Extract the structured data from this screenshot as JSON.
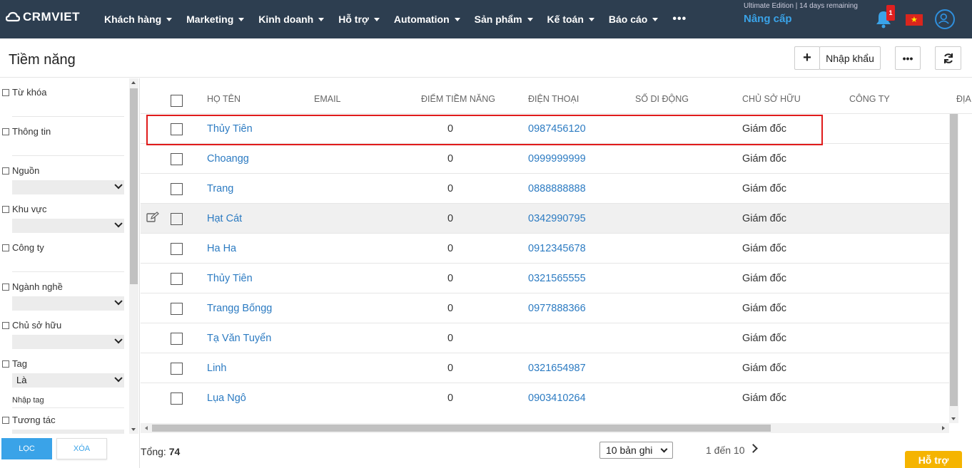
{
  "app": {
    "logo": "CRMVIET"
  },
  "nav": [
    {
      "label": "Khách hàng"
    },
    {
      "label": "Marketing"
    },
    {
      "label": "Kinh doanh"
    },
    {
      "label": "Hỗ trợ"
    },
    {
      "label": "Automation"
    },
    {
      "label": "Sản phẩm"
    },
    {
      "label": "Kế toán"
    },
    {
      "label": "Báo cáo"
    }
  ],
  "nav_more": "•••",
  "edition": "Ultimate Edition | 14 days remaining",
  "upgrade": "Nâng cấp",
  "notif_count": "1",
  "page": {
    "title": "Tiềm năng",
    "add": "+",
    "import": "Nhập khẩu",
    "more": "•••",
    "refresh": "⟳"
  },
  "filters": {
    "keyword": "Từ khóa",
    "info": "Thông tin",
    "source": "Nguồn",
    "region": "Khu vực",
    "company": "Công ty",
    "industry": "Ngành nghề",
    "owner": "Chủ sở hữu",
    "tag": "Tag",
    "tag_select": "Là",
    "tag_input": "Nhập tag",
    "interaction": "Tương tác",
    "filter_btn": "LỌC",
    "clear_btn": "XÓA"
  },
  "table": {
    "headers": [
      "HỌ TÊN",
      "EMAIL",
      "ĐIỂM TIỀM NĂNG",
      "ĐIỆN THOẠI",
      "SỐ DI ĐỘNG",
      "CHỦ SỞ HỮU",
      "CÔNG TY",
      "ĐỊA"
    ],
    "rows": [
      {
        "name": "Thủy Tiên",
        "score": "0",
        "phone": "0987456120",
        "owner": "Giám đốc"
      },
      {
        "name": "Choangg",
        "score": "0",
        "phone": "0999999999",
        "owner": "Giám đốc"
      },
      {
        "name": "Trang",
        "score": "0",
        "phone": "0888888888",
        "owner": "Giám đốc"
      },
      {
        "name": "Hạt Cát",
        "score": "0",
        "phone": "0342990795",
        "owner": "Giám đốc"
      },
      {
        "name": "Ha Ha",
        "score": "0",
        "phone": "0912345678",
        "owner": "Giám đốc"
      },
      {
        "name": "Thủy Tiên",
        "score": "0",
        "phone": "0321565555",
        "owner": "Giám đốc"
      },
      {
        "name": "Trangg Bốngg",
        "score": "0",
        "phone": "0977888366",
        "owner": "Giám đốc"
      },
      {
        "name": "Tạ Văn Tuyển",
        "score": "0",
        "phone": "",
        "owner": "Giám đốc"
      },
      {
        "name": "Linh",
        "score": "0",
        "phone": "0321654987",
        "owner": "Giám đốc"
      },
      {
        "name": "Lụa Ngô",
        "score": "0",
        "phone": "0903410264",
        "owner": "Giám đốc"
      }
    ]
  },
  "footer": {
    "total_label": "Tổng:",
    "total_value": "74",
    "page_size": "10 bản ghi",
    "range": "1 đến 10",
    "help": "Hỗ trợ"
  },
  "colors": {
    "nav_bg": "#2d3e50",
    "accent": "#3aa3e8",
    "link": "#2c7bc2",
    "help": "#f5b400",
    "highlight_box": "#e01b1b"
  }
}
